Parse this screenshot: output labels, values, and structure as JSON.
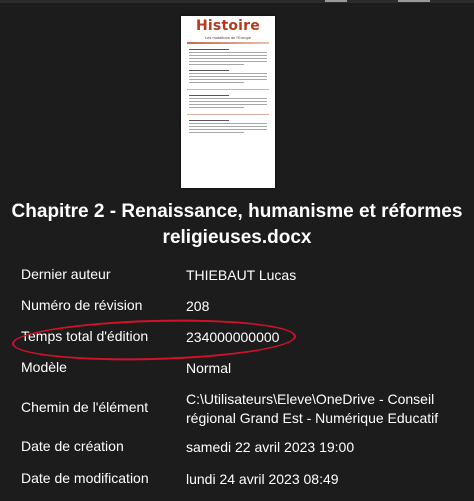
{
  "document": {
    "thumbnail_title": "Histoire",
    "thumbnail_subtitle": "Les mutations de l'Europe",
    "file_name": "Chapitre 2 - Renaissance, humanisme et réformes religieuses.docx"
  },
  "properties": [
    {
      "label": "Dernier auteur",
      "value": "THIEBAUT Lucas"
    },
    {
      "label": "Numéro de révision",
      "value": "208"
    },
    {
      "label": "Temps total d'édition",
      "value": "234000000000"
    },
    {
      "label": "Modèle",
      "value": "Normal"
    },
    {
      "label": "Chemin de l'élément",
      "value": "C:\\Utilisateurs\\Eleve\\OneDrive - Conseil régional Grand Est - Numérique Educatif"
    },
    {
      "label": "Date de création",
      "value": "samedi 22 avril 2023 19:00"
    },
    {
      "label": "Date de modification",
      "value": "lundi 24 avril 2023 08:49"
    }
  ],
  "colors": {
    "background": "#1c1c1c",
    "annotation": "#d3122a",
    "thumbnail_title": "#b33a1d"
  }
}
